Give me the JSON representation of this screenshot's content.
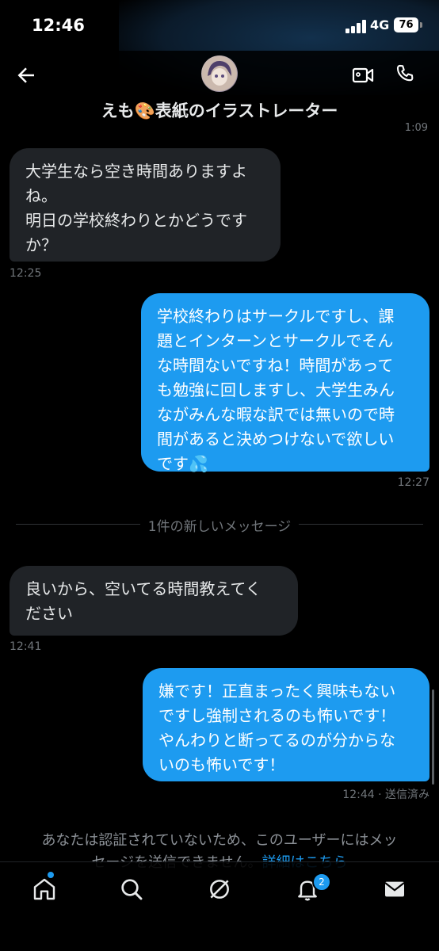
{
  "status_bar": {
    "time": "12:46",
    "network": "4G",
    "battery": "76"
  },
  "header": {
    "title": "えも🎨表紙のイラストレーター",
    "icons": [
      "back-arrow-icon",
      "avatar",
      "video-icon",
      "phone-icon"
    ]
  },
  "top_timestamp": "1:09",
  "messages": [
    {
      "dir": "in",
      "text": "大学生なら空き時間ありますよ\nね。\n明日の学校終わりとかどうです\nか？",
      "time": "12:25"
    },
    {
      "dir": "out",
      "text": "学校終わりはサークルですし、課\n題とインターンとサークルでそん\nな時間ないですね！時間があって\nも勉強に回しますし、大学生みん\nながみんな暇な訳では無いので時\n間があると決めつけないで欲しい\nです💦",
      "time": "12:27"
    },
    {
      "dir": "in",
      "text": "良いから、空いてる時間教えてく\nださい",
      "time": "12:41"
    },
    {
      "dir": "out",
      "text": "嫌です！正直まったく興味もない\nですし強制されるのも怖いです！\nやんわりと断ってるのが分からな\nいのも怖いです！",
      "time": "12:44 · 送信済み"
    }
  ],
  "divider": "1件の新しいメッセージ",
  "notice": {
    "text": "あなたは認証されていないため、このユーザーにはメッ\nセージを送信できません。",
    "link": "詳細はこちら"
  },
  "tabs": {
    "notifications_badge": "2",
    "icons": [
      "home-icon",
      "search-icon",
      "grok-icon",
      "notifications-icon",
      "messages-icon"
    ]
  },
  "colors": {
    "accent": "#1d9bf0",
    "incoming_bubble": "#202327",
    "background": "#000000"
  }
}
